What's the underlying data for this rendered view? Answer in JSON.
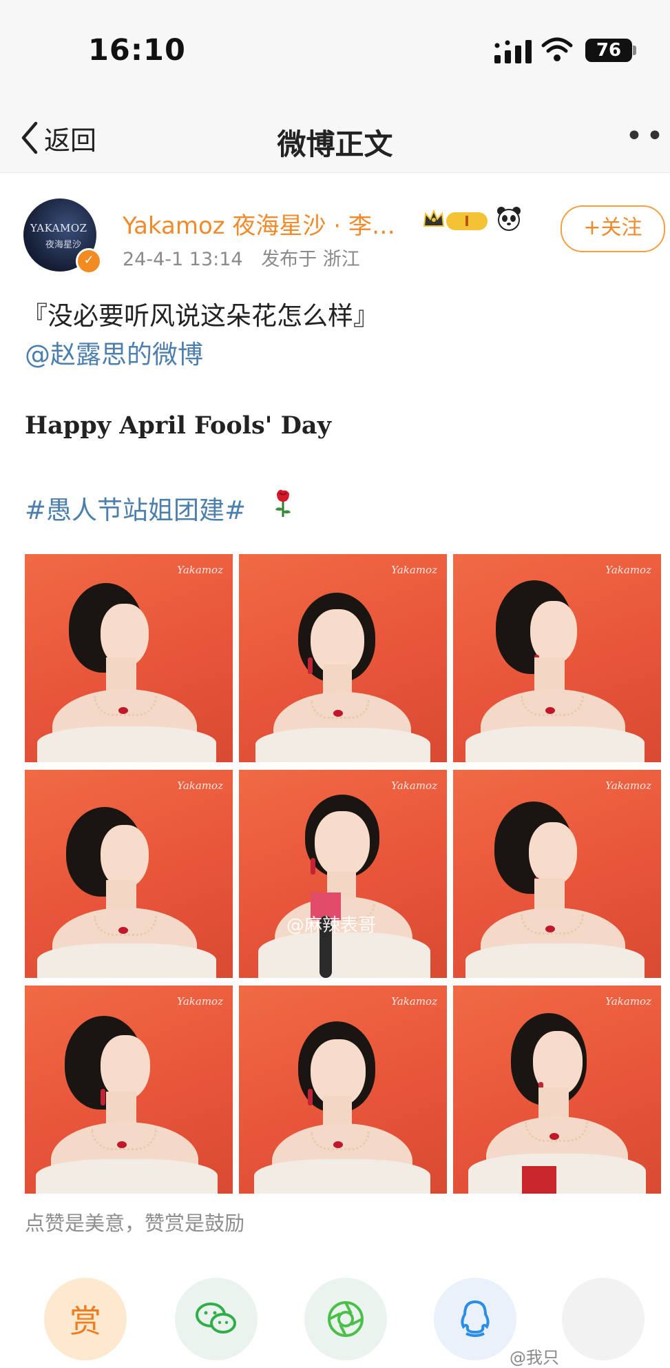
{
  "status_bar": {
    "time": "16:10",
    "battery": "76",
    "icons": [
      "signal-icon",
      "wifi-icon",
      "battery-icon"
    ]
  },
  "nav": {
    "back_label": "返回",
    "title": "微博正文",
    "more_icon": "more-icon"
  },
  "post": {
    "username": "Yakamoz 夜海星沙 · 李…",
    "avatar_text": "YAKAMOZ",
    "avatar_sub": "夜海星沙",
    "level_badge": "I",
    "follow_label": "+关注",
    "date": "24-4-1 13:14",
    "published_label": "发布于 浙江",
    "line1": "『没必要听风说这朵花怎么样』",
    "mention": "@赵露思的微博",
    "english_line": "Happy April Fools' Day",
    "hashtag": "#愚人节站姐团建#",
    "photo_watermark": "Yakamoz",
    "overlay_watermark": "@麻辣表哥",
    "photos": [
      {
        "alt": "photo-1"
      },
      {
        "alt": "photo-2"
      },
      {
        "alt": "photo-3"
      },
      {
        "alt": "photo-4"
      },
      {
        "alt": "photo-5"
      },
      {
        "alt": "photo-6"
      },
      {
        "alt": "photo-7"
      },
      {
        "alt": "photo-8"
      },
      {
        "alt": "photo-9"
      }
    ]
  },
  "footer": {
    "tip": "点赞是美意，赞赏是鼓励",
    "reward_label": "赏",
    "footer_watermark": "@我只"
  },
  "colors": {
    "accent_orange": "#f08a2a",
    "link_blue": "#4d7fae",
    "photo_bg": "#e8553a"
  }
}
